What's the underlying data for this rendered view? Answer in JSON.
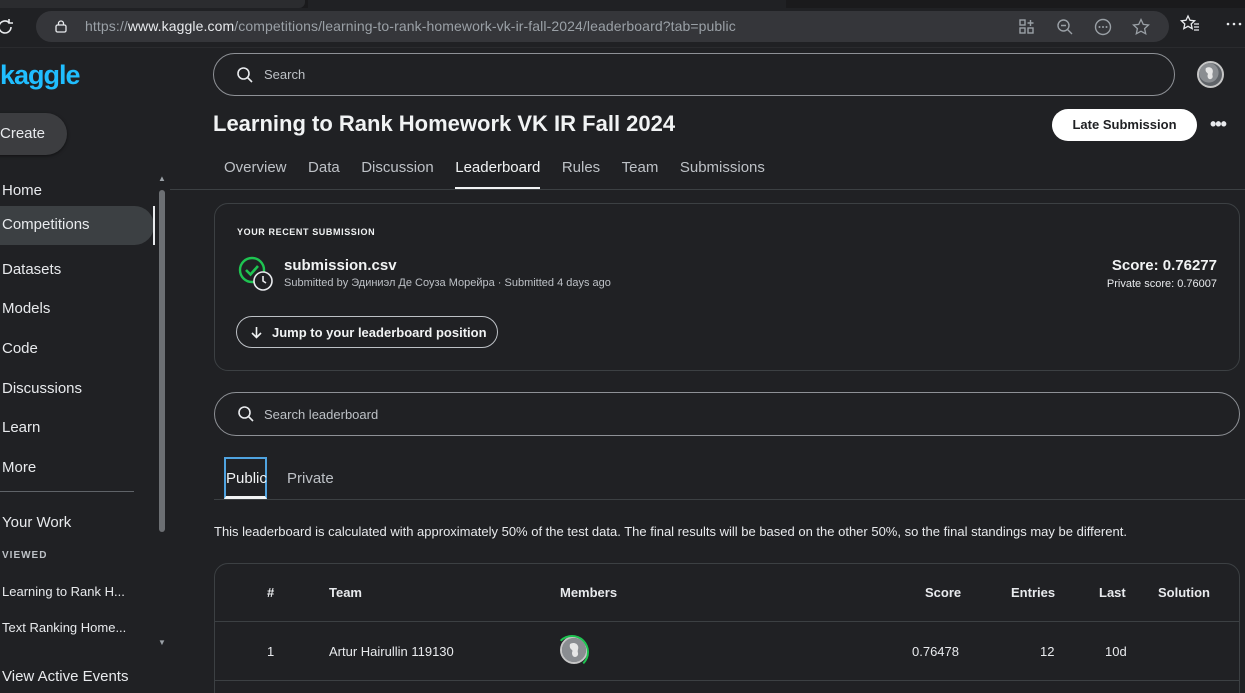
{
  "browser": {
    "url_prefix": "https://",
    "url_domain": "www.kaggle.com",
    "url_path": "/competitions/learning-to-rank-homework-vk-ir-fall-2024/leaderboard?tab=public"
  },
  "sidebar": {
    "logo": "kaggle",
    "create_label": "Create",
    "items": [
      {
        "label": "Home"
      },
      {
        "label": "Competitions"
      },
      {
        "label": "Datasets"
      },
      {
        "label": "Models"
      },
      {
        "label": "Code"
      },
      {
        "label": "Discussions"
      },
      {
        "label": "Learn"
      },
      {
        "label": "More"
      }
    ],
    "your_work": "Your Work",
    "viewed_label": "VIEWED",
    "viewed": [
      "Learning to Rank H...",
      "Text Ranking Home..."
    ],
    "view_active_events": "View Active Events"
  },
  "header": {
    "search_placeholder": "Search",
    "title": "Learning to Rank Homework VK IR Fall 2024",
    "late_submission": "Late Submission",
    "more": "•••",
    "tabs": [
      "Overview",
      "Data",
      "Discussion",
      "Leaderboard",
      "Rules",
      "Team",
      "Submissions"
    ],
    "active_tab": "Leaderboard"
  },
  "recent": {
    "label": "YOUR RECENT SUBMISSION",
    "file": "submission.csv",
    "submitted_by": "Submitted by Эдиниэл Де Соуза Морейра · Submitted 4 days ago",
    "score": "Score: 0.76277",
    "private_score": "Private score: 0.76007",
    "jump_label": "Jump to your leaderboard position"
  },
  "leaderboard": {
    "search_placeholder": "Search leaderboard",
    "subtabs": [
      "Public",
      "Private"
    ],
    "note": "This leaderboard is calculated with approximately 50% of the test data. The final results will be based on the other 50%, so the final standings may be different.",
    "columns": [
      "#",
      "Team",
      "Members",
      "Score",
      "Entries",
      "Last",
      "Solution"
    ],
    "rows": [
      {
        "rank": "1",
        "team": "Artur Hairullin 119130",
        "score": "0.76478",
        "entries": "12",
        "last": "10d"
      }
    ]
  },
  "colors": {
    "accent": "#20beff",
    "background": "#202124",
    "success": "#1ec451"
  }
}
